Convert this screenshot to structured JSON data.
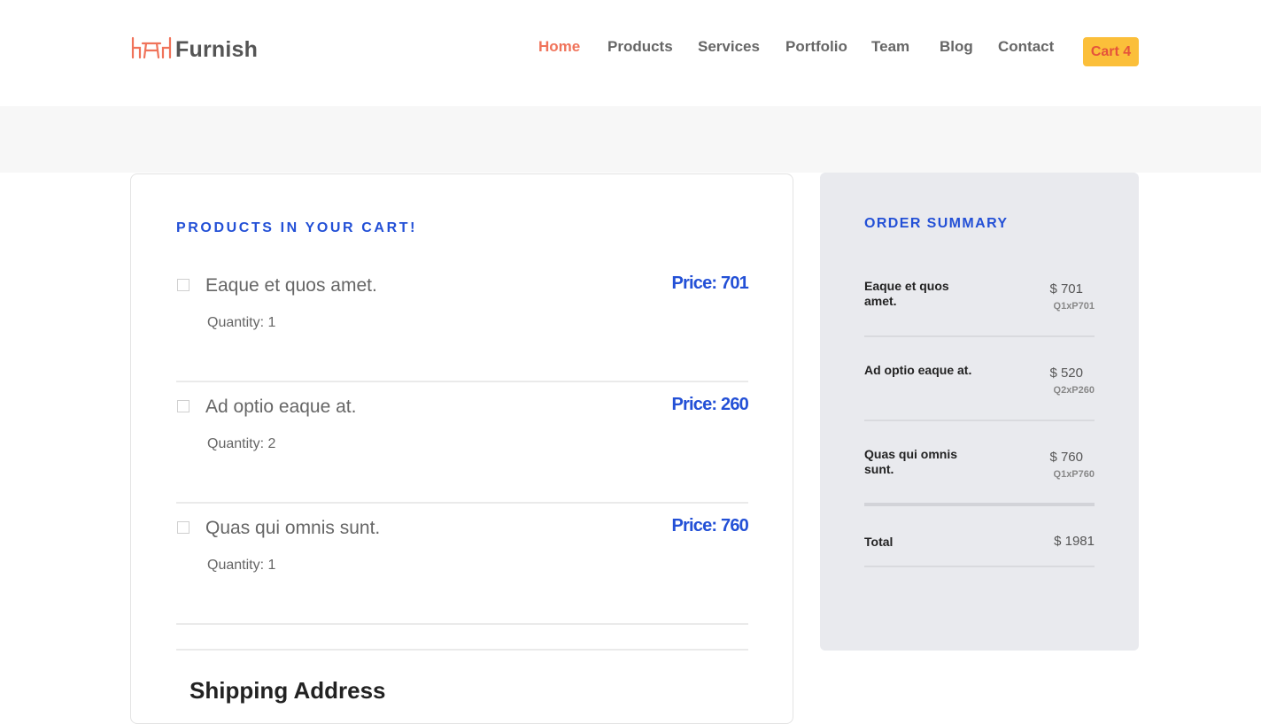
{
  "brand": {
    "name": "Furnish",
    "logo_icon": "chairs-table-icon",
    "accent": "#f0735a"
  },
  "nav": {
    "items": [
      {
        "label": "Home",
        "active": true
      },
      {
        "label": "Products",
        "active": false
      },
      {
        "label": "Services",
        "active": false
      },
      {
        "label": "Portfolio",
        "active": false
      },
      {
        "label": "Team",
        "active": false
      },
      {
        "label": "Blog",
        "active": false
      },
      {
        "label": "Contact",
        "active": false
      }
    ],
    "cart_label": "Cart 4"
  },
  "cart": {
    "heading": "PRODUCTS IN YOUR CART!",
    "items": [
      {
        "name": "Eaque et quos amet.",
        "price": "Price: 701",
        "quantity": "Quantity: 1"
      },
      {
        "name": "Ad optio eaque at.",
        "price": "Price: 260",
        "quantity": "Quantity: 2"
      },
      {
        "name": "Quas qui omnis sunt.",
        "price": "Price: 760",
        "quantity": "Quantity: 1"
      }
    ],
    "shipping_title": "Shipping Address"
  },
  "summary": {
    "heading": "ORDER SUMMARY",
    "items": [
      {
        "name": "Eaque et quos amet.",
        "amount": "$ 701",
        "calc": "Q1xP701"
      },
      {
        "name": "Ad optio eaque at.",
        "amount": "$ 520",
        "calc": "Q2xP260"
      },
      {
        "name": "Quas qui omnis sunt.",
        "amount": "$ 760",
        "calc": "Q1xP760"
      }
    ],
    "total_label": "Total",
    "total_value": "$ 1981"
  },
  "colors": {
    "heading_blue": "#2350d6",
    "cart_button": "#fbbf3a",
    "banner": "#f7f7f7",
    "summary_bg": "#e9eaee"
  }
}
